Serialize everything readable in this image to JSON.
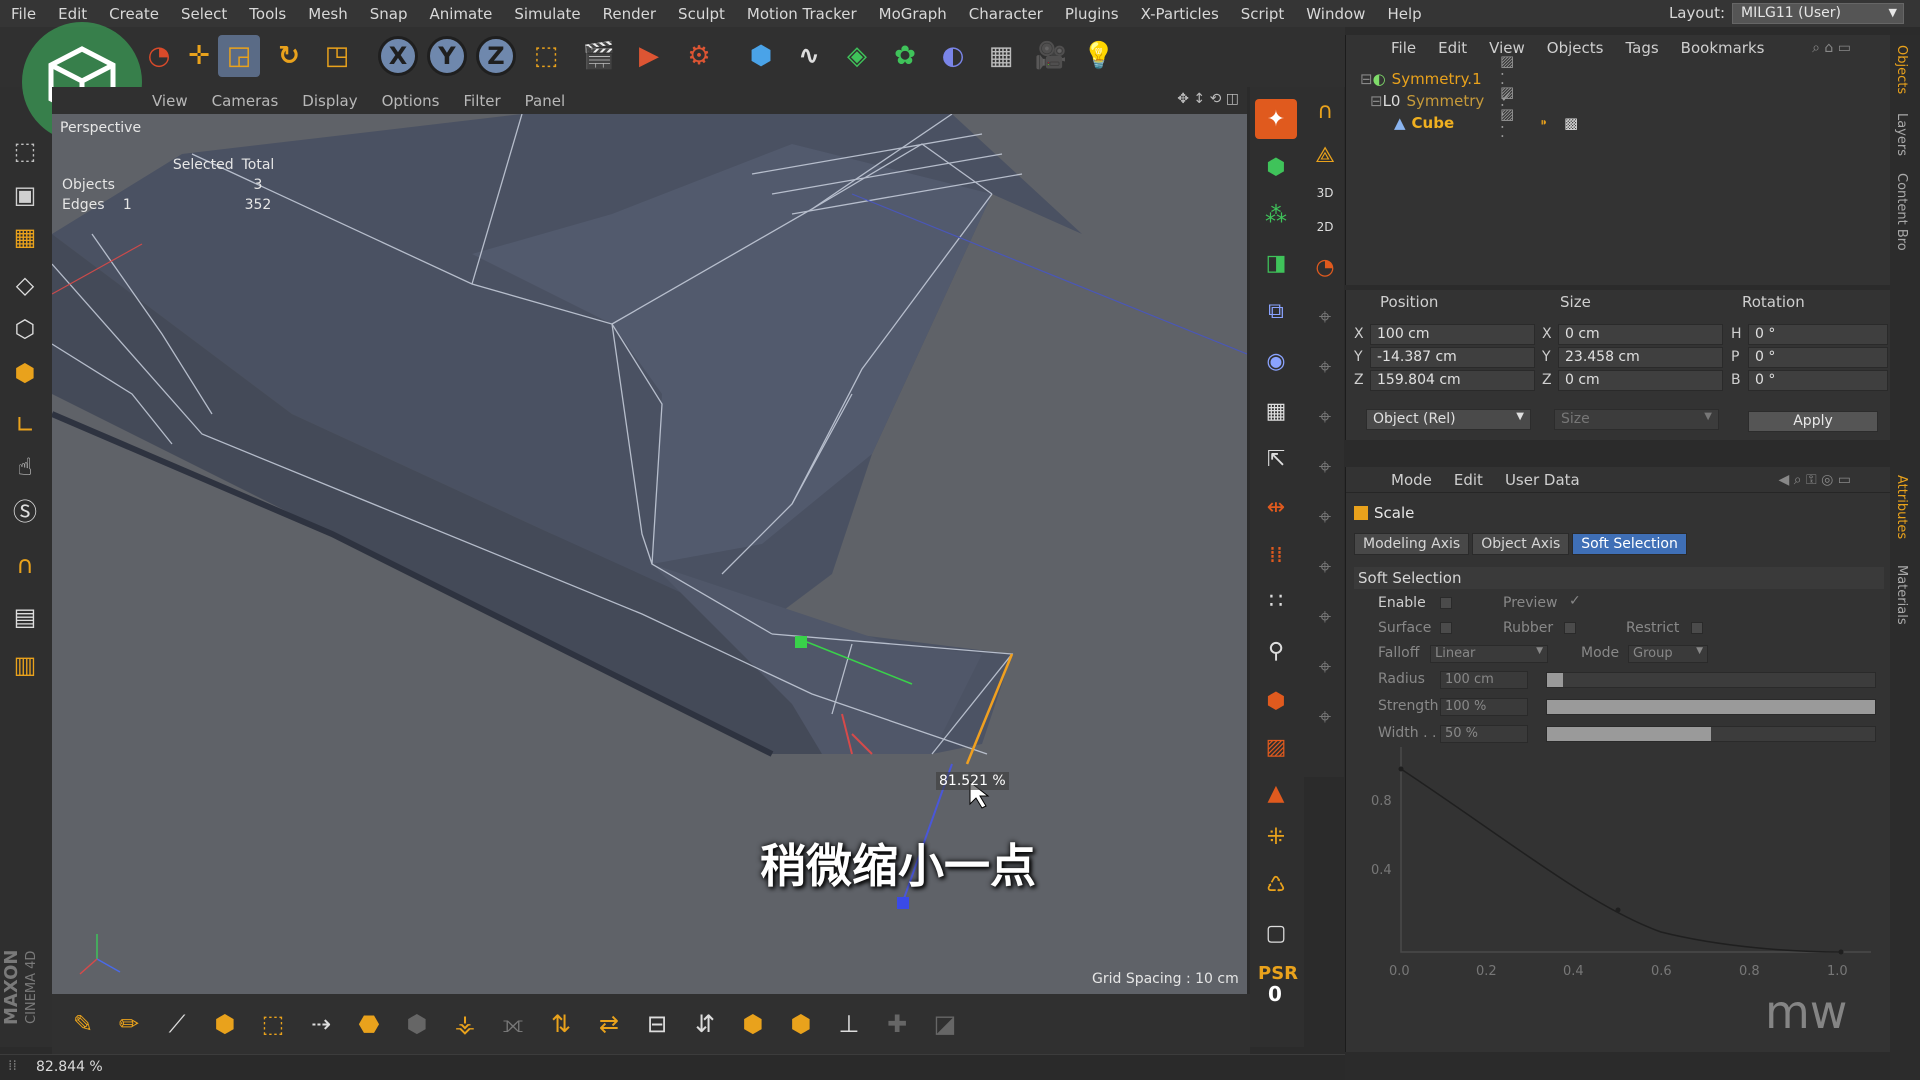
{
  "menubar": {
    "items": [
      "File",
      "Edit",
      "Create",
      "Select",
      "Tools",
      "Mesh",
      "Snap",
      "Animate",
      "Simulate",
      "Render",
      "Sculpt",
      "Motion Tracker",
      "MoGraph",
      "Character",
      "Plugins",
      "X-Particles",
      "Script",
      "Window",
      "Help"
    ],
    "layout_label": "Layout:",
    "layout_value": "MILG11 (User)"
  },
  "toolbar": {
    "axis_x": "X",
    "axis_y": "Y",
    "axis_z": "Z"
  },
  "viewport": {
    "menu": [
      "View",
      "Cameras",
      "Display",
      "Options",
      "Filter",
      "Panel"
    ],
    "camera_name": "Perspective",
    "hud": {
      "col_selected": "Selected",
      "col_total": "Total",
      "objects_label": "Objects",
      "objects_selected": "",
      "objects_total": "3",
      "edges_label": "Edges",
      "edges_selected": "1",
      "edges_total": "352"
    },
    "scale_readout": "81.521 %",
    "grid_spacing": "Grid Spacing : 10 cm",
    "subtitle": "稍微缩小一点"
  },
  "right_tools": {
    "psr_label": "PSR",
    "psr_value": "0"
  },
  "status": {
    "text": "82.844 %"
  },
  "objects_panel": {
    "menu": [
      "File",
      "Edit",
      "View",
      "Objects",
      "Tags",
      "Bookmarks"
    ],
    "items": [
      {
        "name": "Symmetry.1",
        "color": "#e9a21c"
      },
      {
        "name": "Symmetry",
        "color": "#c69a3a"
      },
      {
        "name": "Cube",
        "color": "#f0b020"
      }
    ]
  },
  "coordinates": {
    "position_header": "Position",
    "size_header": "Size",
    "rotation_header": "Rotation",
    "position": {
      "x": "100 cm",
      "y": "-14.387 cm",
      "z": "159.804 cm"
    },
    "size": {
      "x": "0 cm",
      "y": "23.458 cm",
      "z": "0 cm"
    },
    "rotation": {
      "h": "0 °",
      "p": "0 °",
      "b": "0 °"
    },
    "axis_labels": {
      "x": "X",
      "y": "Y",
      "z": "Z",
      "h": "H",
      "p": "P",
      "b": "B"
    },
    "mode_select": "Object (Rel)",
    "size_select": "Size",
    "apply_label": "Apply"
  },
  "attributes": {
    "menu": [
      "Mode",
      "Edit",
      "User Data"
    ],
    "title": "Scale",
    "tabs": [
      "Modeling Axis",
      "Object Axis",
      "Soft Selection"
    ],
    "active_tab": "Soft Selection",
    "section": "Soft Selection",
    "options": {
      "enable": "Enable",
      "preview": "Preview",
      "surface": "Surface",
      "rubber": "Rubber",
      "restrict": "Restrict",
      "falloff": "Falloff",
      "falloff_value": "Linear",
      "mode": "Mode",
      "mode_value": "Group",
      "radius": "Radius",
      "radius_value": "100 cm",
      "strength": "Strength",
      "strength_value": "100 %",
      "width": "Width . .",
      "width_value": "50 %"
    },
    "slider_levels": {
      "radius": 0.05,
      "strength": 1.0,
      "width": 0.5
    },
    "curve_y_ticks": [
      "0.8",
      "0.4"
    ],
    "curve_x_ticks": [
      "0.0",
      "0.2",
      "0.4",
      "0.6",
      "0.8",
      "1.0"
    ]
  },
  "side_tabs": [
    "Objects",
    "Layers",
    "Content Bro",
    "Attributes",
    "Materials"
  ],
  "brand": {
    "maxon": "MAXON",
    "cinema": "CINEMA 4D",
    "watermark": "mw"
  },
  "colors": {
    "accent_orange": "#e9a21c",
    "selection_blue": "#3f6fb6",
    "viewport_bg": "#5d6066"
  }
}
